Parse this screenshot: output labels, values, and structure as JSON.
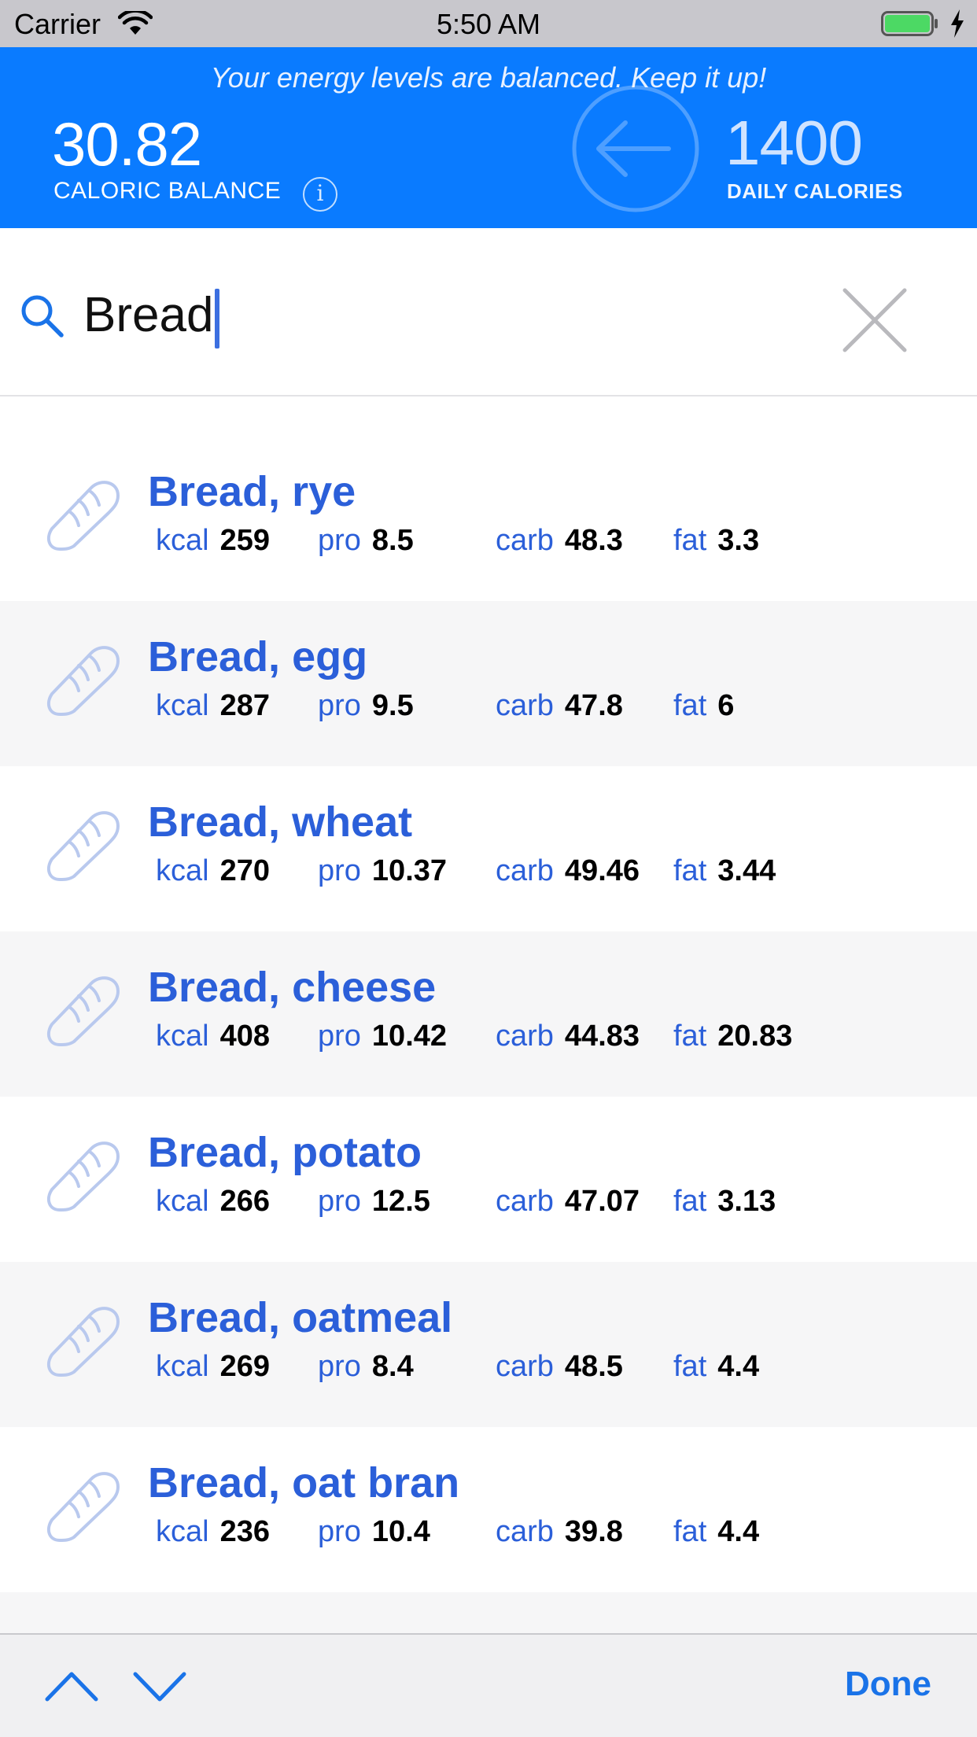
{
  "status_bar": {
    "carrier": "Carrier",
    "time": "5:50 AM"
  },
  "header": {
    "message": "Your energy levels are balanced. Keep it up!",
    "caloric_balance_value": "30.82",
    "caloric_balance_label": "CALORIC BALANCE",
    "info_icon_glyph": "i",
    "daily_calories_value": "1400",
    "daily_calories_label": "DAILY CALORIES",
    "background_color": "#0a7bff"
  },
  "search": {
    "value": "Bread"
  },
  "nutrient_labels": {
    "kcal": "kcal",
    "pro": "pro",
    "carb": "carb",
    "fat": "fat"
  },
  "results": [
    {
      "name": "Bread, rye",
      "kcal": "259",
      "pro": "8.5",
      "carb": "48.3",
      "fat": "3.3"
    },
    {
      "name": "Bread, egg",
      "kcal": "287",
      "pro": "9.5",
      "carb": "47.8",
      "fat": "6"
    },
    {
      "name": "Bread, wheat",
      "kcal": "270",
      "pro": "10.37",
      "carb": "49.46",
      "fat": "3.44"
    },
    {
      "name": "Bread, cheese",
      "kcal": "408",
      "pro": "10.42",
      "carb": "44.83",
      "fat": "20.83"
    },
    {
      "name": "Bread, potato",
      "kcal": "266",
      "pro": "12.5",
      "carb": "47.07",
      "fat": "3.13"
    },
    {
      "name": "Bread, oatmeal",
      "kcal": "269",
      "pro": "8.4",
      "carb": "48.5",
      "fat": "4.4"
    },
    {
      "name": "Bread, oat bran",
      "kcal": "236",
      "pro": "10.4",
      "carb": "39.8",
      "fat": "4.4"
    }
  ],
  "accessory_bar": {
    "done_label": "Done"
  },
  "icons": {
    "status": [
      "wifi-icon",
      "battery-icon",
      "charging-bolt-icon"
    ],
    "header": [
      "info-icon",
      "back-arrow-icon"
    ],
    "search": [
      "search-icon",
      "clear-icon"
    ],
    "row": "bread-icon",
    "accessory": [
      "chevron-up-icon",
      "chevron-down-icon"
    ]
  },
  "colors": {
    "accent": "#2b5fd9",
    "done": "#1a73e8",
    "row_alt": "#f6f6f7"
  }
}
